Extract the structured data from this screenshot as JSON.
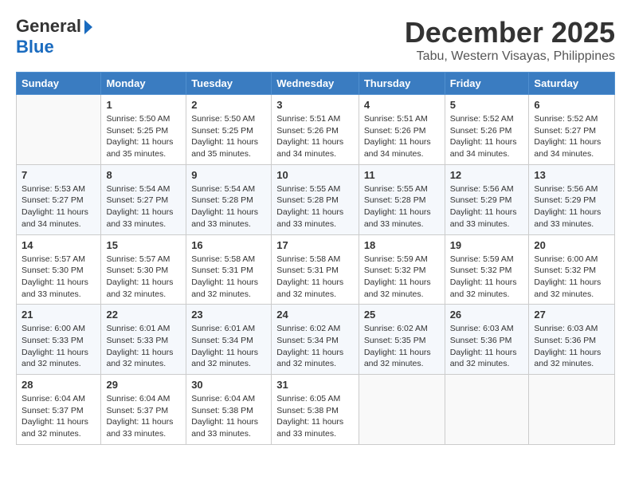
{
  "header": {
    "logo_line1": "General",
    "logo_line2": "Blue",
    "month": "December 2025",
    "location": "Tabu, Western Visayas, Philippines"
  },
  "weekdays": [
    "Sunday",
    "Monday",
    "Tuesday",
    "Wednesday",
    "Thursday",
    "Friday",
    "Saturday"
  ],
  "weeks": [
    [
      {
        "day": "",
        "sunrise": "",
        "sunset": "",
        "daylight": ""
      },
      {
        "day": "1",
        "sunrise": "Sunrise: 5:50 AM",
        "sunset": "Sunset: 5:25 PM",
        "daylight": "Daylight: 11 hours and 35 minutes."
      },
      {
        "day": "2",
        "sunrise": "Sunrise: 5:50 AM",
        "sunset": "Sunset: 5:25 PM",
        "daylight": "Daylight: 11 hours and 35 minutes."
      },
      {
        "day": "3",
        "sunrise": "Sunrise: 5:51 AM",
        "sunset": "Sunset: 5:26 PM",
        "daylight": "Daylight: 11 hours and 34 minutes."
      },
      {
        "day": "4",
        "sunrise": "Sunrise: 5:51 AM",
        "sunset": "Sunset: 5:26 PM",
        "daylight": "Daylight: 11 hours and 34 minutes."
      },
      {
        "day": "5",
        "sunrise": "Sunrise: 5:52 AM",
        "sunset": "Sunset: 5:26 PM",
        "daylight": "Daylight: 11 hours and 34 minutes."
      },
      {
        "day": "6",
        "sunrise": "Sunrise: 5:52 AM",
        "sunset": "Sunset: 5:27 PM",
        "daylight": "Daylight: 11 hours and 34 minutes."
      }
    ],
    [
      {
        "day": "7",
        "sunrise": "Sunrise: 5:53 AM",
        "sunset": "Sunset: 5:27 PM",
        "daylight": "Daylight: 11 hours and 34 minutes."
      },
      {
        "day": "8",
        "sunrise": "Sunrise: 5:54 AM",
        "sunset": "Sunset: 5:27 PM",
        "daylight": "Daylight: 11 hours and 33 minutes."
      },
      {
        "day": "9",
        "sunrise": "Sunrise: 5:54 AM",
        "sunset": "Sunset: 5:28 PM",
        "daylight": "Daylight: 11 hours and 33 minutes."
      },
      {
        "day": "10",
        "sunrise": "Sunrise: 5:55 AM",
        "sunset": "Sunset: 5:28 PM",
        "daylight": "Daylight: 11 hours and 33 minutes."
      },
      {
        "day": "11",
        "sunrise": "Sunrise: 5:55 AM",
        "sunset": "Sunset: 5:28 PM",
        "daylight": "Daylight: 11 hours and 33 minutes."
      },
      {
        "day": "12",
        "sunrise": "Sunrise: 5:56 AM",
        "sunset": "Sunset: 5:29 PM",
        "daylight": "Daylight: 11 hours and 33 minutes."
      },
      {
        "day": "13",
        "sunrise": "Sunrise: 5:56 AM",
        "sunset": "Sunset: 5:29 PM",
        "daylight": "Daylight: 11 hours and 33 minutes."
      }
    ],
    [
      {
        "day": "14",
        "sunrise": "Sunrise: 5:57 AM",
        "sunset": "Sunset: 5:30 PM",
        "daylight": "Daylight: 11 hours and 33 minutes."
      },
      {
        "day": "15",
        "sunrise": "Sunrise: 5:57 AM",
        "sunset": "Sunset: 5:30 PM",
        "daylight": "Daylight: 11 hours and 32 minutes."
      },
      {
        "day": "16",
        "sunrise": "Sunrise: 5:58 AM",
        "sunset": "Sunset: 5:31 PM",
        "daylight": "Daylight: 11 hours and 32 minutes."
      },
      {
        "day": "17",
        "sunrise": "Sunrise: 5:58 AM",
        "sunset": "Sunset: 5:31 PM",
        "daylight": "Daylight: 11 hours and 32 minutes."
      },
      {
        "day": "18",
        "sunrise": "Sunrise: 5:59 AM",
        "sunset": "Sunset: 5:32 PM",
        "daylight": "Daylight: 11 hours and 32 minutes."
      },
      {
        "day": "19",
        "sunrise": "Sunrise: 5:59 AM",
        "sunset": "Sunset: 5:32 PM",
        "daylight": "Daylight: 11 hours and 32 minutes."
      },
      {
        "day": "20",
        "sunrise": "Sunrise: 6:00 AM",
        "sunset": "Sunset: 5:32 PM",
        "daylight": "Daylight: 11 hours and 32 minutes."
      }
    ],
    [
      {
        "day": "21",
        "sunrise": "Sunrise: 6:00 AM",
        "sunset": "Sunset: 5:33 PM",
        "daylight": "Daylight: 11 hours and 32 minutes."
      },
      {
        "day": "22",
        "sunrise": "Sunrise: 6:01 AM",
        "sunset": "Sunset: 5:33 PM",
        "daylight": "Daylight: 11 hours and 32 minutes."
      },
      {
        "day": "23",
        "sunrise": "Sunrise: 6:01 AM",
        "sunset": "Sunset: 5:34 PM",
        "daylight": "Daylight: 11 hours and 32 minutes."
      },
      {
        "day": "24",
        "sunrise": "Sunrise: 6:02 AM",
        "sunset": "Sunset: 5:34 PM",
        "daylight": "Daylight: 11 hours and 32 minutes."
      },
      {
        "day": "25",
        "sunrise": "Sunrise: 6:02 AM",
        "sunset": "Sunset: 5:35 PM",
        "daylight": "Daylight: 11 hours and 32 minutes."
      },
      {
        "day": "26",
        "sunrise": "Sunrise: 6:03 AM",
        "sunset": "Sunset: 5:36 PM",
        "daylight": "Daylight: 11 hours and 32 minutes."
      },
      {
        "day": "27",
        "sunrise": "Sunrise: 6:03 AM",
        "sunset": "Sunset: 5:36 PM",
        "daylight": "Daylight: 11 hours and 32 minutes."
      }
    ],
    [
      {
        "day": "28",
        "sunrise": "Sunrise: 6:04 AM",
        "sunset": "Sunset: 5:37 PM",
        "daylight": "Daylight: 11 hours and 32 minutes."
      },
      {
        "day": "29",
        "sunrise": "Sunrise: 6:04 AM",
        "sunset": "Sunset: 5:37 PM",
        "daylight": "Daylight: 11 hours and 33 minutes."
      },
      {
        "day": "30",
        "sunrise": "Sunrise: 6:04 AM",
        "sunset": "Sunset: 5:38 PM",
        "daylight": "Daylight: 11 hours and 33 minutes."
      },
      {
        "day": "31",
        "sunrise": "Sunrise: 6:05 AM",
        "sunset": "Sunset: 5:38 PM",
        "daylight": "Daylight: 11 hours and 33 minutes."
      },
      {
        "day": "",
        "sunrise": "",
        "sunset": "",
        "daylight": ""
      },
      {
        "day": "",
        "sunrise": "",
        "sunset": "",
        "daylight": ""
      },
      {
        "day": "",
        "sunrise": "",
        "sunset": "",
        "daylight": ""
      }
    ]
  ]
}
